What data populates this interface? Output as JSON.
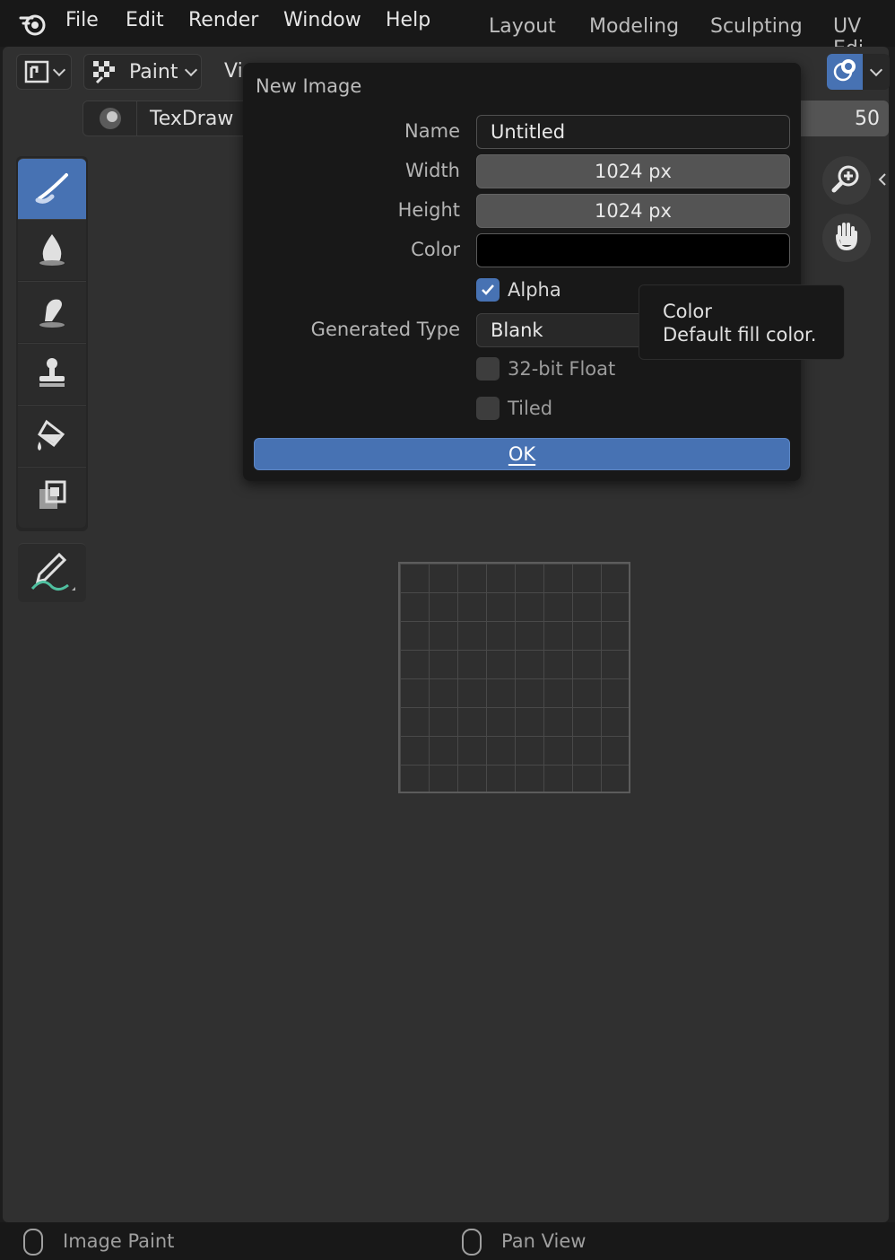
{
  "menubar": {
    "items": [
      "File",
      "Edit",
      "Render",
      "Window",
      "Help"
    ],
    "workspace_tabs": [
      "Layout",
      "Modeling",
      "Sculpting",
      "UV Edi"
    ]
  },
  "header": {
    "mode_label": "Paint",
    "view_label": "Vi",
    "brush_name": "TexDraw",
    "zoom_value": "50"
  },
  "toolbar": {
    "tools": [
      "draw",
      "soften",
      "smear",
      "clone",
      "fill",
      "mask",
      "annotate"
    ],
    "active_tool": "draw"
  },
  "dialog": {
    "title": "New Image",
    "name_label": "Name",
    "name_value": "Untitled",
    "width_label": "Width",
    "width_value": "1024 px",
    "height_label": "Height",
    "height_value": "1024 px",
    "color_label": "Color",
    "color_value": "#000000",
    "alpha_label": "Alpha",
    "alpha_checked": true,
    "generated_type_label": "Generated Type",
    "generated_type_value": "Blank",
    "float_label": "32-bit Float",
    "float_checked": false,
    "tiled_label": "Tiled",
    "tiled_checked": false,
    "ok_label": "OK"
  },
  "tooltip": {
    "title": "Color",
    "description": "Default fill color."
  },
  "statusbar": {
    "left_text": "Image Paint",
    "right_text": "Pan View"
  },
  "colors": {
    "accent": "#4772b3",
    "panel": "#303030",
    "dialog_bg": "#181818"
  }
}
